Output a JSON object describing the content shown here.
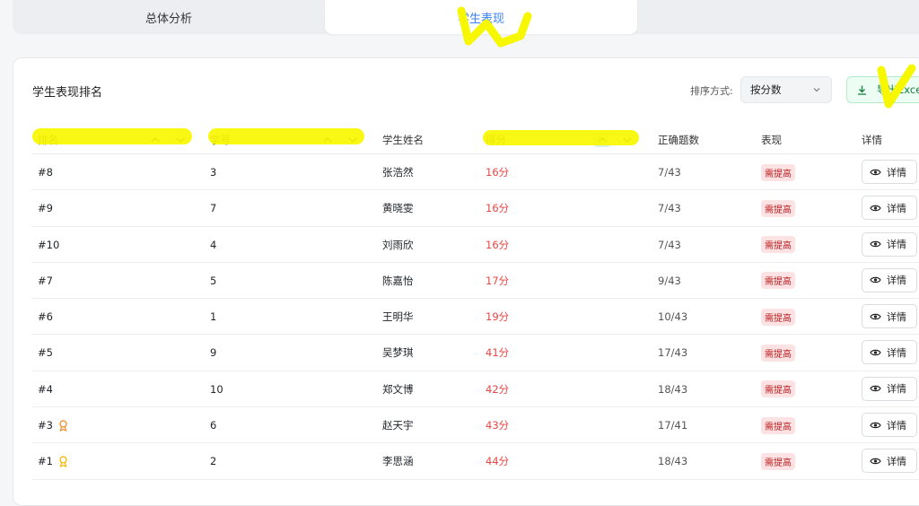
{
  "tabs": [
    {
      "label": "总体分析"
    },
    {
      "label": "学生表现"
    }
  ],
  "card": {
    "title": "学生表现排名",
    "sort_label": "排序方式:",
    "sort_value": "按分数",
    "export_label": "导出Excel"
  },
  "table": {
    "headers": {
      "rank": "排名",
      "id": "学号",
      "name": "学生姓名",
      "score": "得分",
      "correct": "正确题数",
      "perf": "表现",
      "detail": "详情"
    },
    "rows": [
      {
        "rank": "#8",
        "id": "3",
        "name": "张浩然",
        "score": "16分",
        "correct": "7/43",
        "perf": "需提高",
        "detail": "详情"
      },
      {
        "rank": "#9",
        "id": "7",
        "name": "黄晓雯",
        "score": "16分",
        "correct": "7/43",
        "perf": "需提高",
        "detail": "详情"
      },
      {
        "rank": "#10",
        "id": "4",
        "name": "刘雨欣",
        "score": "16分",
        "correct": "7/43",
        "perf": "需提高",
        "detail": "详情"
      },
      {
        "rank": "#7",
        "id": "5",
        "name": "陈嘉怡",
        "score": "17分",
        "correct": "9/43",
        "perf": "需提高",
        "detail": "详情"
      },
      {
        "rank": "#6",
        "id": "1",
        "name": "王明华",
        "score": "19分",
        "correct": "10/43",
        "perf": "需提高",
        "detail": "详情"
      },
      {
        "rank": "#5",
        "id": "9",
        "name": "吴梦琪",
        "score": "41分",
        "correct": "17/43",
        "perf": "需提高",
        "detail": "详情"
      },
      {
        "rank": "#4",
        "id": "10",
        "name": "郑文博",
        "score": "42分",
        "correct": "18/43",
        "perf": "需提高",
        "detail": "详情"
      },
      {
        "rank": "#3",
        "id": "6",
        "name": "赵天宇",
        "score": "43分",
        "correct": "17/41",
        "perf": "需提高",
        "detail": "详情",
        "medal": "bronze-medal-icon"
      },
      {
        "rank": "#1",
        "id": "2",
        "name": "李思涵",
        "score": "44分",
        "correct": "18/43",
        "perf": "需提高",
        "detail": "详情",
        "medal": "gold-medal-icon"
      }
    ]
  },
  "colors": {
    "accent": "#3b82f6",
    "score": "#ef4444",
    "badge_bg": "#fde2e4",
    "badge_text": "#b91c1c",
    "export_text": "#15803d",
    "highlight": "#f7f700"
  }
}
